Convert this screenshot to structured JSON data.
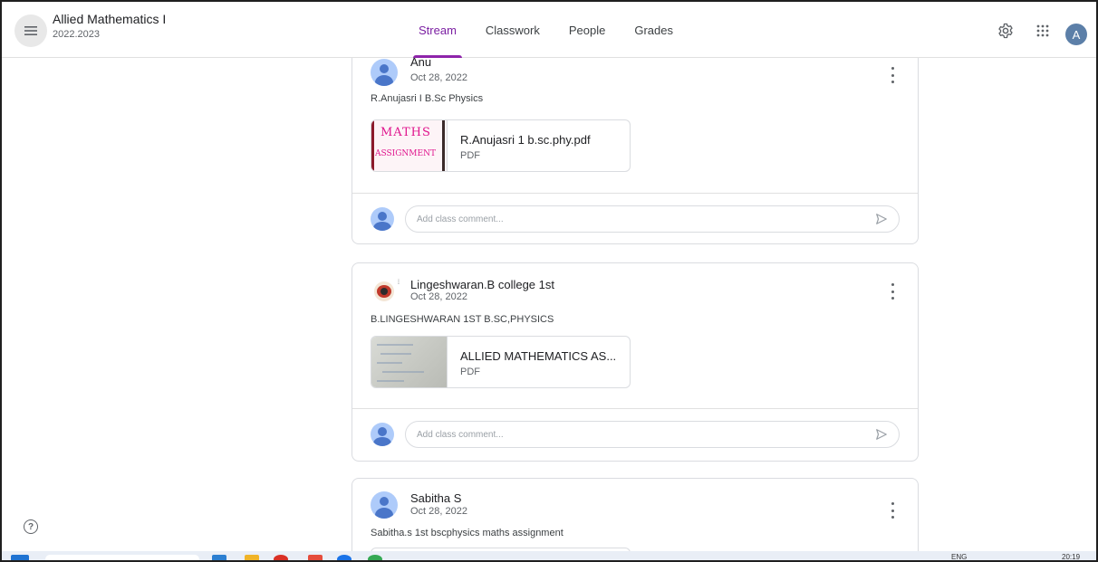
{
  "header": {
    "class_title": "Allied Mathematics I",
    "class_subtitle": "2022.2023",
    "tabs": [
      {
        "label": "Stream",
        "active": true
      },
      {
        "label": "Classwork",
        "active": false
      },
      {
        "label": "People",
        "active": false
      },
      {
        "label": "Grades",
        "active": false
      }
    ],
    "account_initial": "A",
    "icons": [
      "menu-icon",
      "settings-icon",
      "apps-grid-icon"
    ]
  },
  "posts": [
    {
      "author": "Anu",
      "date": "Oct 28, 2022",
      "text": "R.Anujasri I B.Sc Physics",
      "attachment": {
        "title": "R.Anujasri 1 b.sc.phy.pdf",
        "type": "PDF",
        "thumb_text": [
          "MATHS",
          "ASSIGNMENT"
        ]
      },
      "comment_placeholder": "Add class comment..."
    },
    {
      "author": "Lingeshwaran.B college 1st",
      "date": "Oct 28, 2022",
      "text": "B.LINGESHWARAN 1ST B.SC,PHYSICS",
      "attachment": {
        "title": "ALLIED MATHEMATICS AS...",
        "type": "PDF"
      },
      "comment_placeholder": "Add class comment..."
    },
    {
      "author": "Sabitha S",
      "date": "Oct 28, 2022",
      "text": "Sabitha.s 1st bscphysics maths assignment"
    }
  ],
  "taskbar": {
    "lang": "ENG",
    "time": "20:19"
  },
  "colors": {
    "accent": "#7b1fa2",
    "avatar_bg": "#aecbfa",
    "avatar_fg": "#4a76c9"
  }
}
